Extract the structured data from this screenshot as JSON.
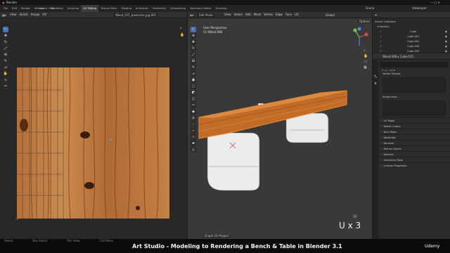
{
  "app": {
    "title": "Blender",
    "title_right": "Scene",
    "view_layer": "ViewLayer"
  },
  "menus": [
    "File",
    "Edit",
    "Render",
    "Window",
    "Help"
  ],
  "workspaces": [
    "Layout",
    "Modeling",
    "Sculpting",
    "UV Editing",
    "Texture Paint",
    "Shading",
    "Animation",
    "Rendering",
    "Compositing",
    "Geometry Nodes",
    "Scripting"
  ],
  "active_workspace": "UV Editing",
  "uv_editor": {
    "header": [
      "View",
      "Select",
      "Image",
      "UV"
    ],
    "image_name": "Wood_015_basecolor.jpg.001"
  },
  "viewport": {
    "mode": "Edit Mode",
    "header": [
      "View",
      "Select",
      "Add",
      "Mesh",
      "Vertex",
      "Edge",
      "Face",
      "UV"
    ],
    "transform": "Global",
    "perspective": "User Perspective",
    "object_info": "(1) Wood.008",
    "options": "Options",
    "status": "Graph UV Project"
  },
  "outliner": {
    "title": "Scene Collection",
    "collection": "Collection",
    "items": [
      "Cube",
      "Cube.001",
      "Cube.002",
      "Cube.003",
      "Cube.004"
    ]
  },
  "properties": {
    "breadcrumb": [
      "Wood.008",
      "Cube.015"
    ],
    "name_field": "Cube.015",
    "sections_top": [
      "Vertex Groups",
      "Shape Keys"
    ],
    "sections": [
      "UV Maps",
      "Vertex Colors",
      "Face Maps",
      "Attributes",
      "Normals",
      "Texture Space",
      "Remesh",
      "Geometry Data",
      "Custom Properties"
    ]
  },
  "statusbar": {
    "items": [
      "Select",
      "Box Select",
      "Pan View",
      "Call Menu"
    ]
  },
  "overlay": {
    "key_hint": "U x 3"
  },
  "caption": {
    "title": "Art Studio - Modeling to Rendering a Bench & Table in Blender 3.1"
  },
  "brand": "Udemy",
  "colors": {
    "accent": "#4772b3",
    "wood": "#b7703a",
    "mesh": "#e6e6e6",
    "orange_select": "#f0892b"
  },
  "icons": [
    "blender-icon",
    "cursor-icon",
    "move-icon",
    "rotate-icon",
    "scale-icon",
    "transform-icon",
    "annotate-icon",
    "measure-icon",
    "zoom-icon",
    "hand-icon",
    "camera-icon",
    "grid-icon",
    "gizmo-icon",
    "funnel-icon",
    "wrench-icon",
    "mesh-data-icon"
  ]
}
